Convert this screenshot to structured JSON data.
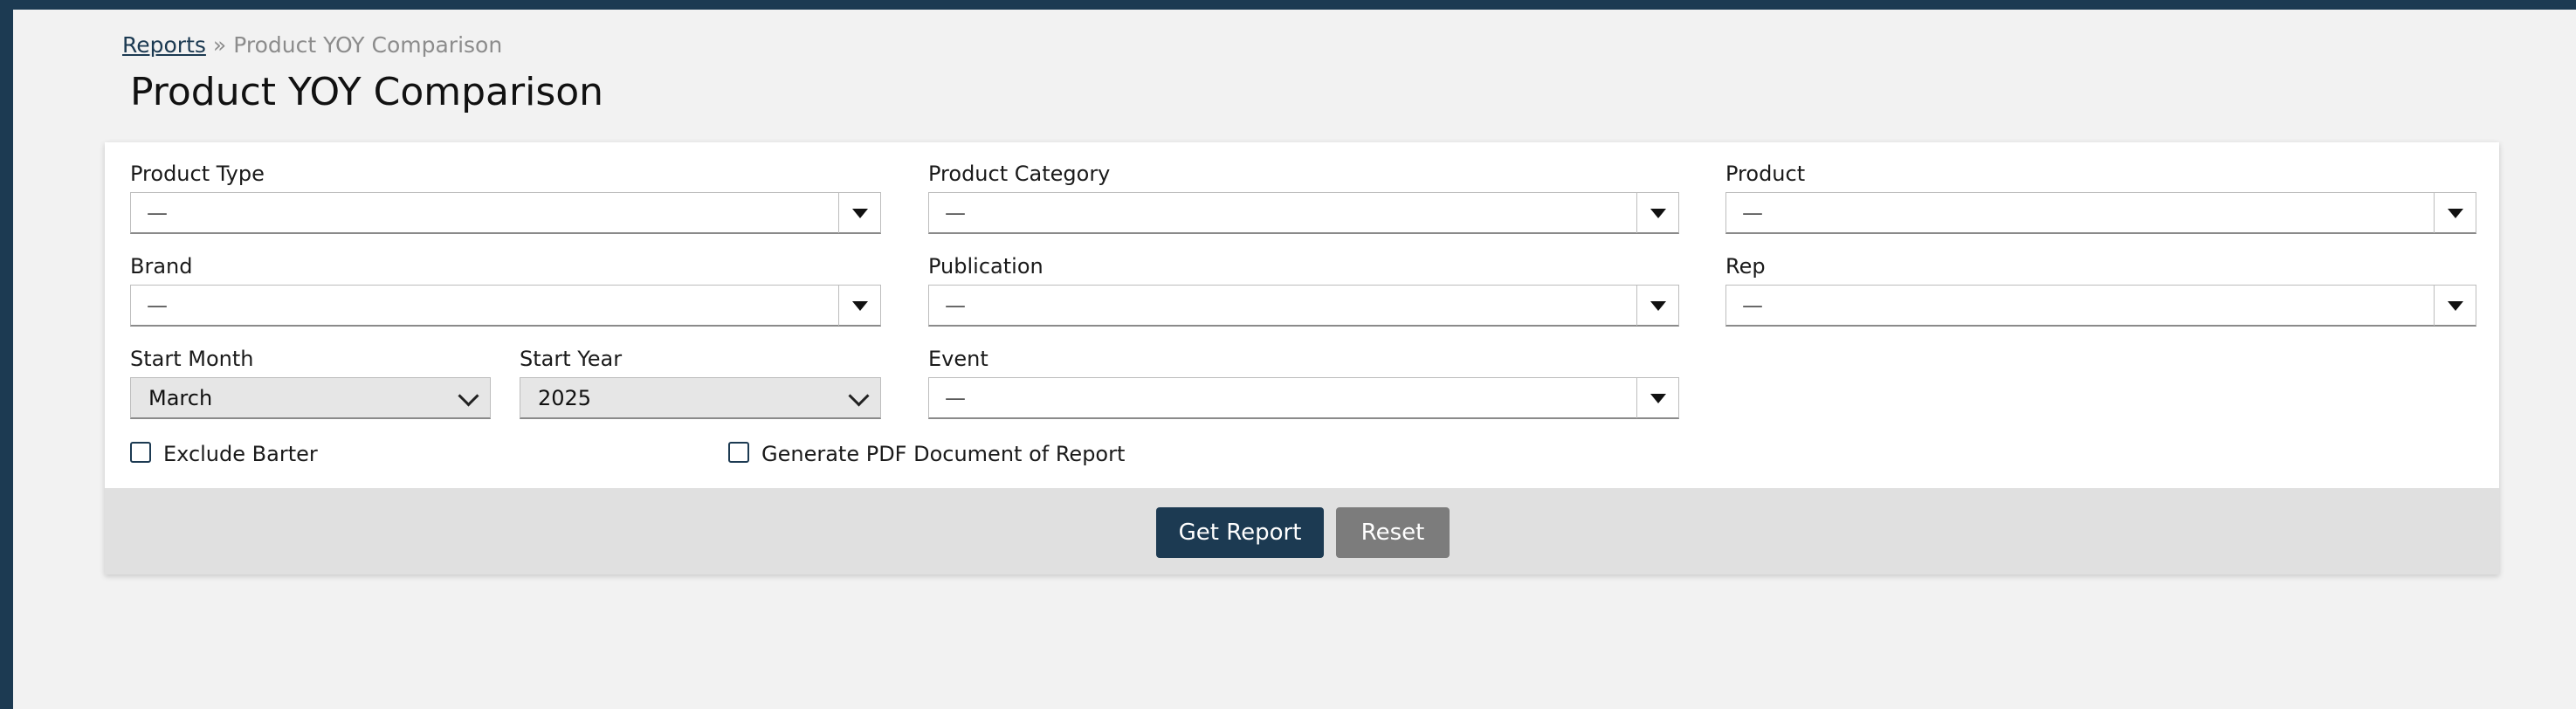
{
  "breadcrumb": {
    "parent": "Reports",
    "separator": "»",
    "current": "Product YOY Comparison"
  },
  "page": {
    "title": "Product YOY Comparison"
  },
  "filters": {
    "product_type": {
      "label": "Product Type",
      "value": "—"
    },
    "product_category": {
      "label": "Product Category",
      "value": "—"
    },
    "product": {
      "label": "Product",
      "value": "—"
    },
    "brand": {
      "label": "Brand",
      "value": "—"
    },
    "publication": {
      "label": "Publication",
      "value": "—"
    },
    "rep": {
      "label": "Rep",
      "value": "—"
    },
    "start_month": {
      "label": "Start Month",
      "value": "March"
    },
    "start_year": {
      "label": "Start Year",
      "value": "2025"
    },
    "event": {
      "label": "Event",
      "value": "—"
    }
  },
  "options": {
    "exclude_barter": {
      "label": "Exclude Barter",
      "checked": false
    },
    "generate_pdf": {
      "label": "Generate PDF Document of Report",
      "checked": false
    }
  },
  "actions": {
    "get_report": "Get Report",
    "reset": "Reset"
  },
  "colors": {
    "brand_navy": "#1c3a52",
    "secondary_gray": "#7c7c7c",
    "page_background": "#f2f2f2"
  },
  "icons": {
    "dropdown": "caret-down-icon",
    "select": "chevron-down-icon",
    "checkbox": "checkbox-icon"
  }
}
